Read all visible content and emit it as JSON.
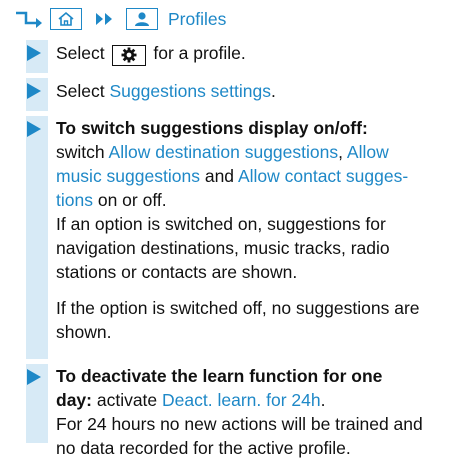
{
  "nav": {
    "arrow_icon": "turn-right-arrow-icon",
    "home_icon": "home-icon",
    "chevron_icon": "double-chevron-right-icon",
    "profile_icon": "profile-icon",
    "label": "Profiles"
  },
  "steps": [
    {
      "pre": "Select ",
      "icon": "gear-icon",
      "post": " for a profile."
    },
    {
      "pre": "Select ",
      "link": "Suggestions settings",
      "post": "."
    },
    {
      "heading": "To switch suggestions display on/off:",
      "line1_pre": "switch ",
      "link1": "Allow destination suggestions",
      "sep1": ", ",
      "link2a": "Allow",
      "link2b": "music suggestions",
      "sep2": " and ",
      "link3a": "Allow contact sugges-",
      "link3b": "tions",
      "tail": " on or off.",
      "para1": "If an option is switched on, suggestions for navigation destinations, music tracks, radio stations or contacts are shown.",
      "para2": "If the option is switched off, no suggestions are shown."
    },
    {
      "heading_a": "To deactivate the learn function for one",
      "heading_b": "day:",
      "mid": " activate ",
      "link": "Deact. learn. for 24h",
      "post": ".",
      "para": "For 24 hours no new actions will be trained and no data recorded for the active profile."
    }
  ],
  "colors": {
    "accent": "#1e88c7",
    "bar": "#d7eaf6"
  }
}
